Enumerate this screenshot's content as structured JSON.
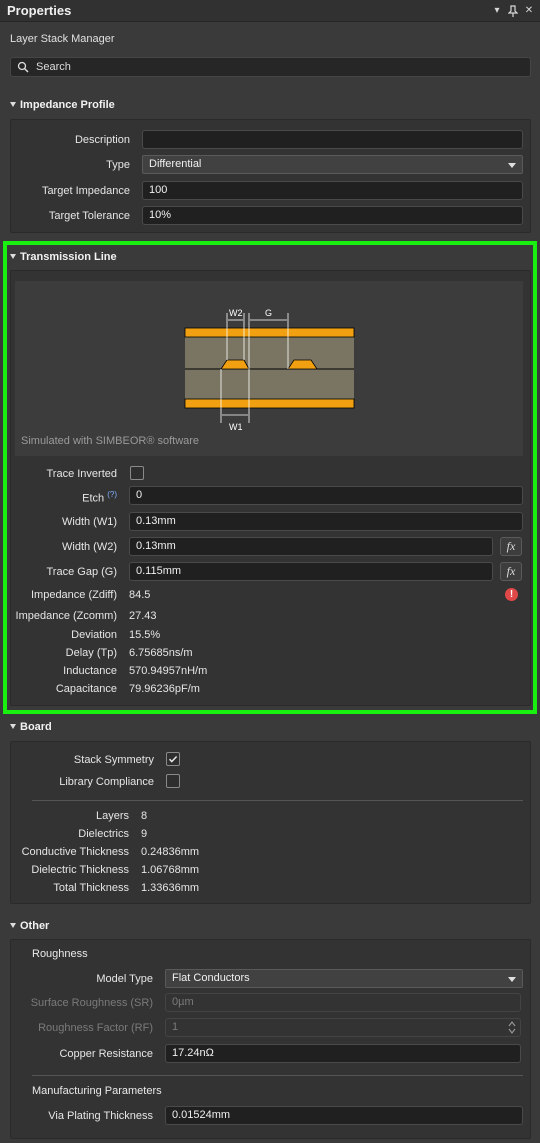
{
  "window": {
    "title": "Properties"
  },
  "subtitle": "Layer Stack Manager",
  "search": {
    "placeholder": "Search"
  },
  "impedance_profile": {
    "header": "Impedance Profile",
    "description_label": "Description",
    "description_value": "",
    "type_label": "Type",
    "type_value": "Differential",
    "target_impedance_label": "Target Impedance",
    "target_impedance_value": "100",
    "target_tolerance_label": "Target Tolerance",
    "target_tolerance_value": "10%"
  },
  "transmission_line": {
    "header": "Transmission Line",
    "diagram": {
      "w2": "W2",
      "g": "G",
      "w1": "W1",
      "caption": "Simulated with SIMBEOR® software"
    },
    "trace_inverted_label": "Trace Inverted",
    "trace_inverted_checked": false,
    "etch_label": "Etch",
    "etch_help": "(?)",
    "etch_value": "0",
    "width_w1_label": "Width (W1)",
    "width_w1_value": "0.13mm",
    "width_w2_label": "Width (W2)",
    "width_w2_value": "0.13mm",
    "trace_gap_label": "Trace Gap (G)",
    "trace_gap_value": "0.115mm",
    "fx": "fx",
    "zdiff_label": "Impedance (Zdiff)",
    "zdiff_value": "84.5",
    "zcomm_label": "Impedance (Zcomm)",
    "zcomm_value": "27.43",
    "deviation_label": "Deviation",
    "deviation_value": "15.5%",
    "delay_label": "Delay (Tp)",
    "delay_value": "6.75685ns/m",
    "inductance_label": "Inductance",
    "inductance_value": "570.94957nH/m",
    "capacitance_label": "Capacitance",
    "capacitance_value": "79.96236pF/m",
    "warning_glyph": "!"
  },
  "board": {
    "header": "Board",
    "stack_symmetry_label": "Stack Symmetry",
    "stack_symmetry_checked": true,
    "library_compliance_label": "Library Compliance",
    "library_compliance_checked": false,
    "layers_label": "Layers",
    "layers_value": "8",
    "dielectrics_label": "Dielectrics",
    "dielectrics_value": "9",
    "conductive_label": "Conductive Thickness",
    "conductive_value": "0.24836mm",
    "dielectric_label": "Dielectric Thickness",
    "dielectric_value": "1.06768mm",
    "total_label": "Total Thickness",
    "total_value": "1.33636mm"
  },
  "other": {
    "header": "Other",
    "roughness_header": "Roughness",
    "model_type_label": "Model Type",
    "model_type_value": "Flat Conductors",
    "surface_roughness_label": "Surface Roughness (SR)",
    "surface_roughness_value": "0µm",
    "roughness_factor_label": "Roughness Factor (RF)",
    "roughness_factor_value": "1",
    "copper_resistance_label": "Copper Resistance",
    "copper_resistance_value": "17.24nΩ",
    "manufacturing_header": "Manufacturing Parameters",
    "via_plating_label": "Via Plating Thickness",
    "via_plating_value": "0.01524mm"
  },
  "colors": {
    "highlight": "#19f00f",
    "copper": "#f0a010",
    "dielectric": "#7a7462",
    "warning": "#e04848"
  }
}
